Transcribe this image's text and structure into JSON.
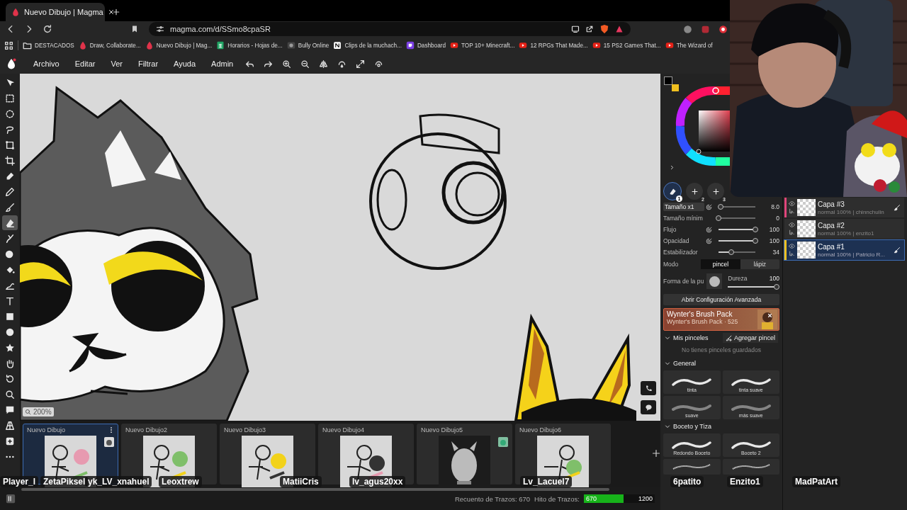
{
  "browser": {
    "tab": {
      "title": "Nuevo Dibujo | Magma"
    },
    "url": "magma.com/d/SSmo8cpaSR",
    "bookmarks": [
      {
        "label": "DESTACADOS",
        "kind": "folder"
      },
      {
        "label": "Draw, Collaborate...",
        "kind": "magma"
      },
      {
        "label": "Nuevo Dibujo | Mag...",
        "kind": "magma"
      },
      {
        "label": "Horarios - Hojas de...",
        "kind": "sheets"
      },
      {
        "label": "Bully Online",
        "kind": "game"
      },
      {
        "label": "Clips de la muchach...",
        "kind": "notion"
      },
      {
        "label": "Dashboard",
        "kind": "twitch"
      },
      {
        "label": "TOP 10+ Minecraft...",
        "kind": "youtube"
      },
      {
        "label": "12 RPGs That Made...",
        "kind": "youtube"
      },
      {
        "label": "15 PS2 Games That...",
        "kind": "youtube"
      },
      {
        "label": "The Wizard of",
        "kind": "youtube"
      }
    ]
  },
  "menu": [
    "Archivo",
    "Editar",
    "Ver",
    "Filtrar",
    "Ayuda",
    "Admin"
  ],
  "tools": [
    {
      "selected": false
    },
    {
      "selected": false
    },
    {
      "selected": false
    },
    {
      "selected": false
    },
    {
      "selected": false
    },
    {
      "selected": false
    },
    {
      "selected": false
    },
    {
      "selected": false
    },
    {
      "selected": false
    },
    {
      "selected": true
    },
    {
      "selected": false
    },
    {
      "selected": false
    },
    {
      "selected": false
    },
    {
      "selected": false
    },
    {
      "selected": false
    },
    {
      "selected": false
    },
    {
      "selected": false
    },
    {
      "selected": false
    },
    {
      "selected": false
    },
    {
      "selected": false
    },
    {
      "selected": false
    },
    {
      "selected": false
    },
    {
      "selected": false
    },
    {
      "selected": false
    },
    {
      "selected": false
    }
  ],
  "canvas": {
    "zoom": "200%"
  },
  "brush_slots": [
    {
      "label": "1",
      "selected": true
    },
    {
      "label": "2",
      "selected": false
    },
    {
      "label": "3",
      "selected": false
    }
  ],
  "sliders": [
    {
      "label": "Tamaño x1",
      "value": "8.0",
      "level": 0.05,
      "pressure": true
    },
    {
      "label": "Tamaño mínim",
      "value": "0",
      "level": 0,
      "pressure": false
    },
    {
      "label": "Flujo",
      "value": "100",
      "level": 1,
      "pressure": true
    },
    {
      "label": "Opacidad",
      "value": "100",
      "level": 1,
      "pressure": true
    },
    {
      "label": "Estabilizador",
      "value": "34",
      "level": 0.34,
      "pressure": false
    }
  ],
  "mode": {
    "label": "Modo",
    "options": [
      {
        "label": "pincel",
        "selected": true
      },
      {
        "label": "lápiz",
        "selected": false
      }
    ]
  },
  "tip": {
    "label": "Forma de la pu",
    "hardness_label": "Dureza",
    "hardness_value": "100",
    "level": 1
  },
  "advanced_button": "Abrir Configuración Avanzada",
  "promo": {
    "title": "Wynter's Brush Pack",
    "subtitle": "Wynter's Brush Pack · 525"
  },
  "my_brushes": {
    "title": "Mis pinceles",
    "expanded": true,
    "add_button": "Agregar pincel",
    "empty_text": "No tienes pinceles guardados"
  },
  "brush_groups": [
    {
      "title": "General",
      "expanded": true,
      "brushes": [
        {
          "label": "tinta",
          "kind": "hard"
        },
        {
          "label": "tinta suave",
          "kind": "hard"
        },
        {
          "label": "suave",
          "kind": "soft"
        },
        {
          "label": "más suave",
          "kind": "soft"
        }
      ]
    },
    {
      "title": "Boceto y Tiza",
      "expanded": true,
      "brushes": [
        {
          "label": "Redondo Boceto",
          "kind": "hard"
        },
        {
          "label": "Boceto 2",
          "kind": "hard"
        },
        {
          "kind": "sketch"
        },
        {
          "kind": "sketch"
        }
      ]
    }
  ],
  "layers": [
    {
      "name": "Capa #3",
      "info": "normal 100% | chinnchulin",
      "selected": false,
      "editing": true,
      "color": "#e0457b"
    },
    {
      "name": "Capa #2",
      "info": "normal 100% | enzito1",
      "selected": false,
      "editing": false
    },
    {
      "name": "Capa #1",
      "info": "normal 100% | Patricio R...",
      "selected": true,
      "editing": true,
      "color": "#f0c020"
    }
  ],
  "drawings": [
    {
      "title": "Nuevo Dibujo",
      "selected": true,
      "avatar": true
    },
    {
      "title": "Nuevo Dibujo2",
      "selected": false,
      "avatar": false
    },
    {
      "title": "Nuevo Dibujo3",
      "selected": false,
      "avatar": false
    },
    {
      "title": "Nuevo Dibujo4",
      "selected": false,
      "avatar": false
    },
    {
      "title": "Nuevo Dibujo5",
      "selected": false,
      "avatar": true
    },
    {
      "title": "Nuevo Dibujo6",
      "selected": false,
      "avatar": false
    }
  ],
  "status": {
    "count_label": "Recuento de Trazos: 670",
    "milestone_label": "Hito de Trazos:",
    "milestone_value": "670",
    "milestone_target": "1200",
    "level": 0.558
  },
  "stream_names": [
    "Player_l",
    "ZetaPiksel",
    "yk_LV_xnahuel",
    "Leoxtrew",
    "MatiiCris",
    "lv_agus20xx",
    "Lv_Lacuel7",
    "6patito",
    "Enzito1",
    "MadPatArt"
  ]
}
